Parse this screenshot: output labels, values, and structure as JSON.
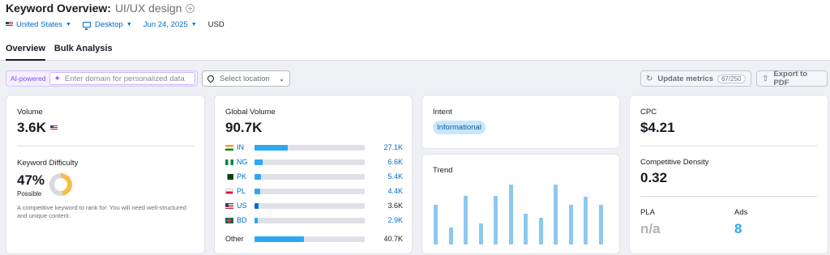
{
  "header": {
    "title": "Keyword Overview:",
    "keyword": "UI/UX design",
    "filters": {
      "country": "United States",
      "device": "Desktop",
      "date": "Jun 24, 2025",
      "currency": "USD"
    },
    "tabs": [
      {
        "label": "Overview",
        "active": true
      },
      {
        "label": "Bulk Analysis",
        "active": false
      }
    ]
  },
  "toolbar": {
    "ai_badge": "AI-powered",
    "domain_placeholder": "Enter domain for personalized data",
    "location_placeholder": "Select location",
    "update_label": "Update metrics",
    "update_counter": "67/250",
    "export_label": "Export to PDF"
  },
  "volume": {
    "label": "Volume",
    "value": "3.6K",
    "flag": "us-flag-icon"
  },
  "keyword_difficulty": {
    "label": "Keyword Difficulty",
    "value": "47%",
    "percent": 47,
    "level": "Possible",
    "description": "A competitive keyword to rank for. You will need well-structured and unique content.",
    "ring_color": "#f7be4a"
  },
  "global_volume": {
    "label": "Global Volume",
    "value": "90.7K",
    "countries": [
      {
        "code": "IN",
        "value": "27.1K",
        "share": 0.3
      },
      {
        "code": "NG",
        "value": "6.6K",
        "share": 0.073
      },
      {
        "code": "PK",
        "value": "5.4K",
        "share": 0.06
      },
      {
        "code": "PL",
        "value": "4.4K",
        "share": 0.049
      },
      {
        "code": "US",
        "value": "3.6K",
        "share": 0.04
      },
      {
        "code": "BD",
        "value": "2.9K",
        "share": 0.032
      }
    ],
    "other": {
      "label": "Other",
      "value": "40.7K",
      "share": 0.45
    },
    "bar_color": "#2ea7f4"
  },
  "intent": {
    "label": "Intent",
    "value": "Informational"
  },
  "trend": {
    "label": "Trend",
    "values": [
      0.66,
      0.28,
      0.81,
      0.35,
      0.81,
      1.0,
      0.52,
      0.45,
      1.0,
      0.66,
      0.8,
      0.66
    ],
    "bar_color": "#8cc8ef"
  },
  "cpc": {
    "label": "CPC",
    "value": "$4.21"
  },
  "competitive_density": {
    "label": "Competitive Density",
    "value": "0.32"
  },
  "pla": {
    "label": "PLA",
    "value": "n/a"
  },
  "ads": {
    "label": "Ads",
    "value": "8"
  }
}
